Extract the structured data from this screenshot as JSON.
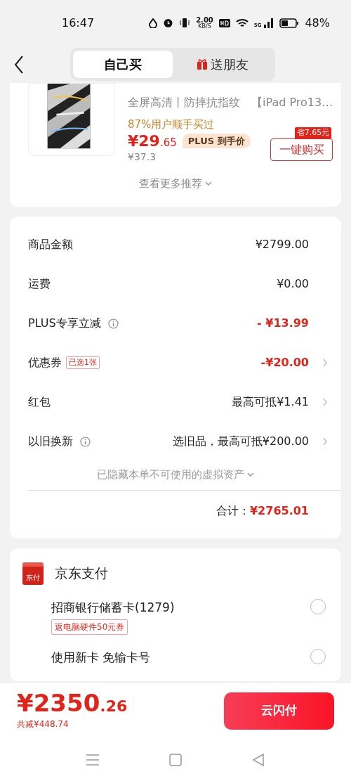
{
  "status_bar": {
    "time": "16:47",
    "speed_value": "2.00",
    "speed_unit": "KB/S",
    "network": "5G",
    "battery": "48%"
  },
  "header": {
    "tabs": [
      {
        "label": "自己买",
        "selected": true,
        "kind": "plain"
      },
      {
        "label": "送朋友",
        "selected": false,
        "kind": "gift"
      }
    ]
  },
  "recommendation": {
    "features": "全屏高清丨防摔抗指纹",
    "title": "【iPad Pro13…",
    "buyers": "87%用户顺手买过",
    "price_yuan": "¥29",
    "price_cents": ".65",
    "plus_tag": "PLUS 到手价",
    "original_price": "¥37.3",
    "save_badge": "省7.65元",
    "buy_button": "一键购买",
    "more": "查看更多推荐"
  },
  "summary": {
    "rows": [
      {
        "label": "商品金额",
        "info": false,
        "value": "¥2799.00",
        "emphasis": false,
        "arrow": false
      },
      {
        "label": "运费",
        "info": false,
        "value": "¥0.00",
        "emphasis": false,
        "arrow": false
      },
      {
        "label": "PLUS专享立减",
        "info": true,
        "value": "- ¥13.99",
        "emphasis": true,
        "arrow": false
      },
      {
        "label": "优惠券",
        "info": false,
        "tag": "已选1张",
        "value": "-¥20.00",
        "emphasis": true,
        "arrow": true
      },
      {
        "label": "红包",
        "info": false,
        "value": "最高可抵¥1.41",
        "emphasis": false,
        "arrow": true
      },
      {
        "label": "以旧换新",
        "info": true,
        "value": "选旧品，最高可抵¥200.00",
        "emphasis": false,
        "arrow": true
      }
    ],
    "hidden_assets": "已隐藏本单不可使用的虚拟资产",
    "total_label": "合计：",
    "total_value": "¥2765.01"
  },
  "payment": {
    "logo": "东付",
    "title": "京东支付",
    "methods": [
      {
        "name": "招商银行储蓄卡(1279)",
        "tag": "返电脑硬件50元券",
        "selected": false
      },
      {
        "name": "使用新卡 免输卡号",
        "selected": false
      }
    ]
  },
  "footer": {
    "price_yuan": "¥2350",
    "price_cents": ".26",
    "saved": "共减¥448.74",
    "pay_button": "云闪付"
  }
}
